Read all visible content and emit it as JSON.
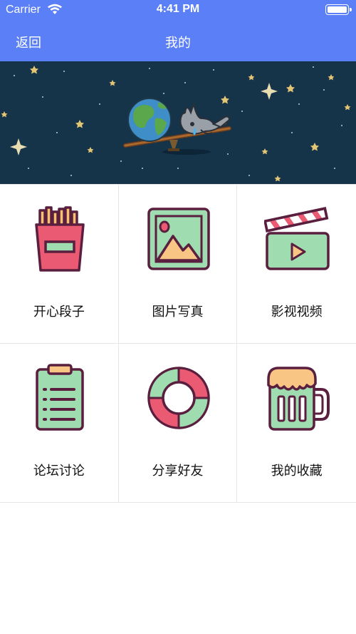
{
  "status_bar": {
    "carrier": "Carrier",
    "time": "4:41 PM"
  },
  "nav": {
    "back_label": "返回",
    "title": "我的"
  },
  "colors": {
    "header": "#5b7ff7",
    "banner_bg": "#15344a",
    "icon_outline": "#5a1f3f",
    "icon_pink": "#ea5a73",
    "icon_green": "#9fdcb0",
    "icon_orange": "#f9c585"
  },
  "grid": {
    "items": [
      {
        "label": "开心段子",
        "icon": "fries-box-icon"
      },
      {
        "label": "图片写真",
        "icon": "picture-icon"
      },
      {
        "label": "影视视频",
        "icon": "clapperboard-icon"
      },
      {
        "label": "论坛讨论",
        "icon": "clipboard-icon"
      },
      {
        "label": "分享好友",
        "icon": "lifebuoy-icon"
      },
      {
        "label": "我的收藏",
        "icon": "beer-mug-icon"
      }
    ]
  }
}
